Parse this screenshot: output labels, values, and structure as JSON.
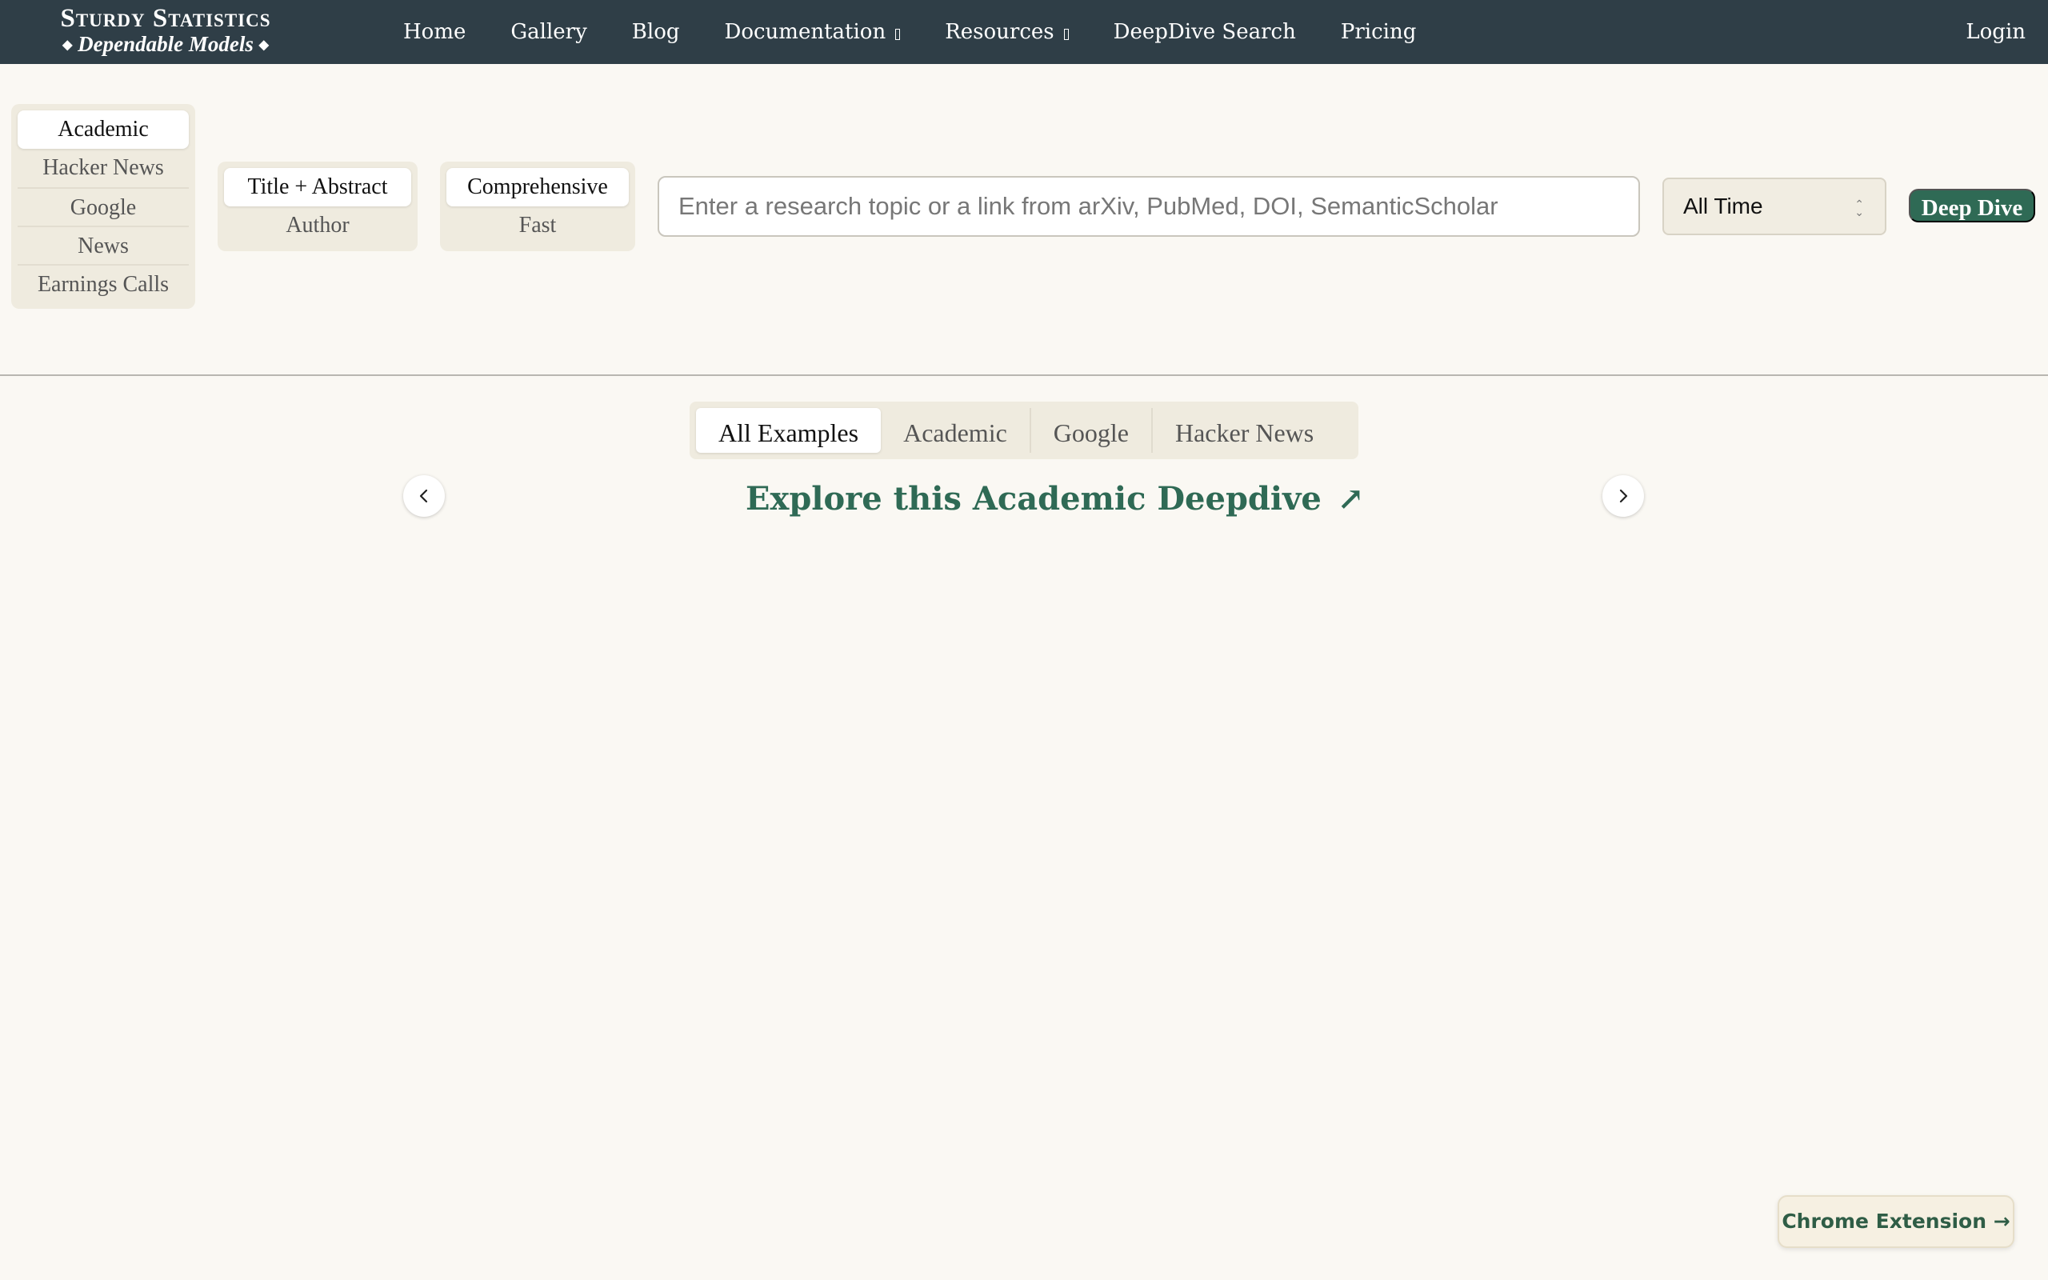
{
  "navbar": {
    "logo_title": "Sturdy Statistics",
    "logo_subtitle": "Dependable Models",
    "logo_ornament": "◆",
    "items": [
      {
        "label": "Home",
        "dropdown": false
      },
      {
        "label": "Gallery",
        "dropdown": false
      },
      {
        "label": "Blog",
        "dropdown": false
      },
      {
        "label": "Documentation",
        "dropdown": true
      },
      {
        "label": "Resources",
        "dropdown": true
      },
      {
        "label": "DeepDive Search",
        "dropdown": false
      },
      {
        "label": "Pricing",
        "dropdown": false
      }
    ],
    "login_label": "Login"
  },
  "search": {
    "sources": [
      "Academic",
      "Hacker News",
      "Google",
      "News",
      "Earnings Calls"
    ],
    "source_active": "Academic",
    "fields": [
      "Title + Abstract",
      "Author"
    ],
    "field_active": "Title + Abstract",
    "depths": [
      "Comprehensive",
      "Fast"
    ],
    "depth_active": "Comprehensive",
    "placeholder": "Enter a research topic or a link from arXiv, PubMed, DOI, SemanticScholar",
    "time_value": "All Time",
    "submit_label": "Deep Dive"
  },
  "examples": {
    "tabs": [
      "All Examples",
      "Academic",
      "Google",
      "Hacker News"
    ],
    "active_tab": "All Examples",
    "link_label": "Explore this Academic Deepdive",
    "link_icon": "↗"
  },
  "chrome_extension_label": "Chrome Extension →",
  "colors": {
    "navbar": "#2f3e47",
    "accent_green": "#2f6a55",
    "background": "#faf8f3"
  }
}
